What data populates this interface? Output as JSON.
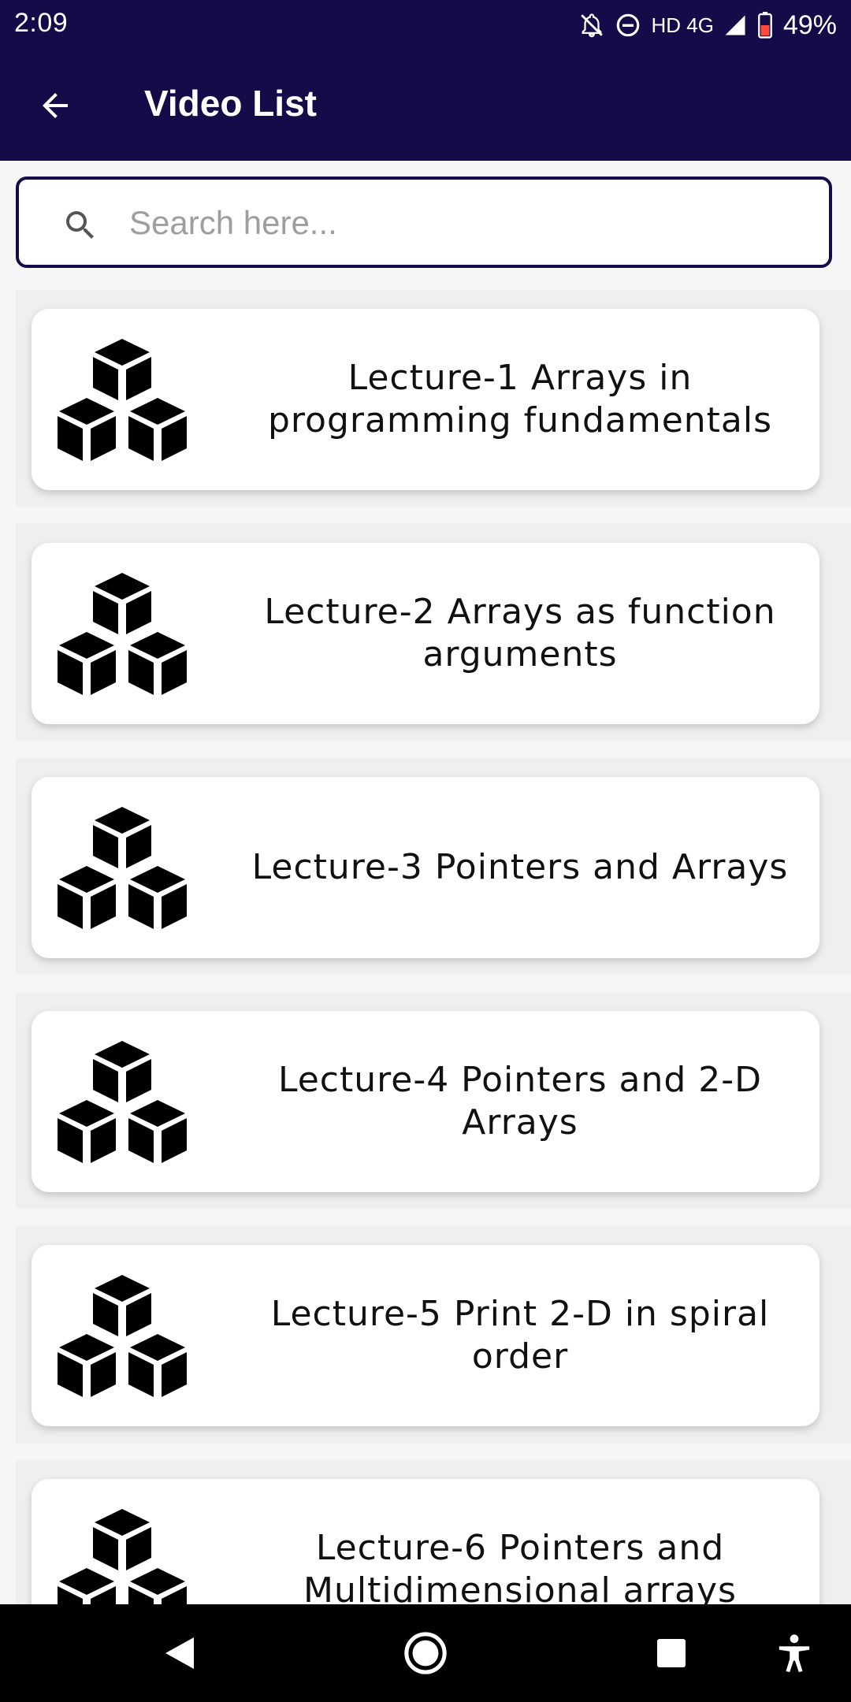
{
  "status_bar": {
    "time": "2:09",
    "network": "HD 4G",
    "battery": "49%"
  },
  "app_bar": {
    "title": "Video List"
  },
  "search": {
    "placeholder": "Search here...",
    "value": ""
  },
  "lectures": [
    {
      "title": "Lecture-1 Arrays in programming fundamentals",
      "icon": "cubes-icon"
    },
    {
      "title": "Lecture-2 Arrays as function arguments",
      "icon": "cubes-icon"
    },
    {
      "title": "Lecture-3 Pointers and Arrays",
      "icon": "cubes-icon"
    },
    {
      "title": "Lecture-4 Pointers and 2-D Arrays",
      "icon": "cubes-icon"
    },
    {
      "title": "Lecture-5 Print 2-D in spiral order",
      "icon": "cubes-icon"
    },
    {
      "title": "Lecture-6 Pointers and Multidimensional arrays",
      "icon": "cubes-icon"
    }
  ],
  "colors": {
    "primary": "#150b48",
    "background": "#f6f6f6",
    "card": "#ffffff"
  }
}
